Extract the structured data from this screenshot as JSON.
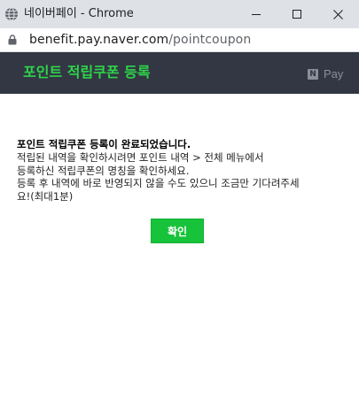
{
  "window": {
    "title": "네이버페이 - Chrome",
    "url_host": "benefit.pay.naver.com",
    "url_path": "/pointcoupon"
  },
  "header": {
    "title": "포인트 적립쿠폰 등록",
    "brand_n": "N",
    "brand_pay": "Pay"
  },
  "message": {
    "title": "포인트 적립쿠폰 등록이 완료되었습니다.",
    "lines": [
      "적립된 내역을 확인하시려면 포인트 내역 > 전체 메뉴에서",
      "등록하신 적립쿠폰의 명칭을 확인하세요.",
      "등록 후 내역에 바로 반영되지 않을 수도 있으니 조금만 기다려주세",
      "요!(최대1분)"
    ]
  },
  "confirm_label": "확인",
  "colors": {
    "header_bg": "#323743",
    "header_title": "#2ed34a",
    "button_bg": "#17c33a"
  },
  "icons": [
    "globe-icon",
    "minimize-icon",
    "maximize-icon",
    "close-icon",
    "lock-icon",
    "naver-pay-logo"
  ]
}
